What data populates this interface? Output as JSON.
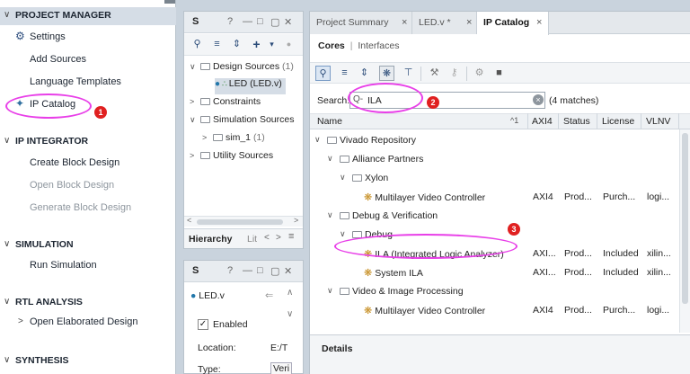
{
  "flow_navigator": {
    "sections": [
      {
        "label": "PROJECT MANAGER"
      },
      {
        "label": "IP INTEGRATOR"
      },
      {
        "label": "SIMULATION"
      },
      {
        "label": "RTL ANALYSIS"
      },
      {
        "label": "SYNTHESIS"
      }
    ],
    "items": {
      "settings": "Settings",
      "add_sources": "Add Sources",
      "language_templates": "Language Templates",
      "ip_catalog": "IP Catalog",
      "create_block_design": "Create Block Design",
      "open_block_design": "Open Block Design",
      "generate_block_design": "Generate Block Design",
      "run_simulation": "Run Simulation",
      "open_elaborated_design": "Open Elaborated Design"
    }
  },
  "sources_panel": {
    "title": "S",
    "tree": {
      "design_sources": "Design Sources",
      "design_sources_count": "(1)",
      "led": "LED (LED.v)",
      "constraints": "Constraints",
      "simulation_sources": "Simulation Sources",
      "sim_1": "sim_1",
      "sim_1_count": "(1)",
      "utility_sources": "Utility Sources"
    },
    "tabs": {
      "hierarchy": "Hierarchy",
      "libraries": "Lit"
    }
  },
  "properties_panel": {
    "title": "S",
    "file": "LED.v",
    "enabled_label": "Enabled",
    "location_label": "Location:",
    "location_value": "E:/T",
    "type_label": "Type:",
    "type_value": "Veri"
  },
  "main": {
    "tabs": [
      {
        "label": "Project Summary"
      },
      {
        "label": "LED.v *"
      },
      {
        "label": "IP Catalog"
      }
    ],
    "subtabs": {
      "cores": "Cores",
      "separator": "|",
      "interfaces": "Interfaces"
    },
    "search": {
      "label": "Search:",
      "value": "ILA",
      "matches": "(4 matches)"
    },
    "columns": [
      "Name",
      "AXI4",
      "Status",
      "License",
      "VLNV"
    ],
    "sort_indicator": "^1",
    "rows": [
      {
        "name": "Vivado Repository",
        "level": 0,
        "folder": true
      },
      {
        "name": "Alliance Partners",
        "level": 1,
        "folder": true
      },
      {
        "name": "Xylon",
        "level": 2,
        "folder": true
      },
      {
        "name": "Multilayer Video Controller",
        "level": 3,
        "axi4": "AXI4",
        "status": "Prod...",
        "license": "Purch...",
        "vlnv": "logi..."
      },
      {
        "name": "Debug & Verification",
        "level": 1,
        "folder": true
      },
      {
        "name": "Debug",
        "level": 2,
        "folder": true
      },
      {
        "name": "ILA (Integrated Logic Analyzer)",
        "level": 3,
        "axi4": "AXI...",
        "status": "Prod...",
        "license": "Included",
        "vlnv": "xilin..."
      },
      {
        "name": "System ILA",
        "level": 3,
        "axi4": "AXI...",
        "status": "Prod...",
        "license": "Included",
        "vlnv": "xilin..."
      },
      {
        "name": "Video & Image Processing",
        "level": 1,
        "folder": true
      },
      {
        "name": "Multilayer Video Controller",
        "level": 3,
        "axi4": "AXI4",
        "status": "Prod...",
        "license": "Purch...",
        "vlnv": "logi..."
      }
    ],
    "details_label": "Details"
  },
  "annotations": [
    "1",
    "2",
    "3"
  ],
  "colors": {
    "annotation": "#e83fe8",
    "badge": "#e02020",
    "selection": "#d5dde6"
  }
}
